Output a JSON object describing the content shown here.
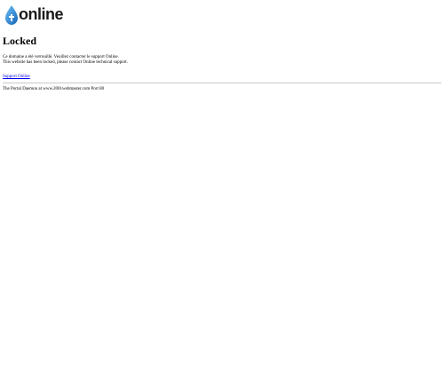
{
  "logo": {
    "text": "online",
    "icon": "t-online-drop-icon",
    "accent_color": "#1e82d6"
  },
  "title": "Locked",
  "message": {
    "line_fr": "Ce domaine a été verrouillé. Veuillez contacter le support Online.",
    "line_en": "This website has been locked, please contact Online technical support."
  },
  "support_link": "Support Online",
  "footer": "The Portal Daemon at www.2001webmaster.com Port 80"
}
